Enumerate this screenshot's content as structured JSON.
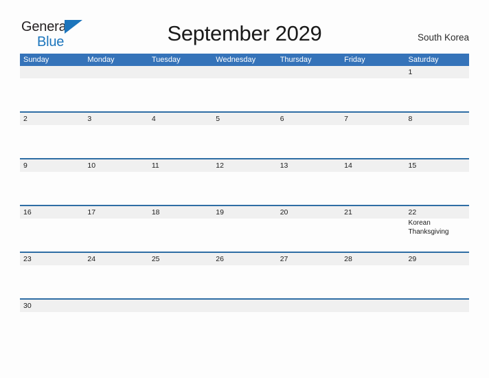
{
  "brand": {
    "name_part1": "General",
    "name_part2": "Blue",
    "triangle_icon": "blue-triangle-icon",
    "accent_color": "#1c75bc"
  },
  "header": {
    "title": "September 2029",
    "region": "South Korea"
  },
  "calendar": {
    "header_color": "#3573b9",
    "row_divider_color": "#2e6da4",
    "band_color": "#f0f0f0",
    "weekdays": [
      "Sunday",
      "Monday",
      "Tuesday",
      "Wednesday",
      "Thursday",
      "Friday",
      "Saturday"
    ],
    "weeks": [
      [
        {
          "day": "",
          "event": ""
        },
        {
          "day": "",
          "event": ""
        },
        {
          "day": "",
          "event": ""
        },
        {
          "day": "",
          "event": ""
        },
        {
          "day": "",
          "event": ""
        },
        {
          "day": "",
          "event": ""
        },
        {
          "day": "1",
          "event": ""
        }
      ],
      [
        {
          "day": "2",
          "event": ""
        },
        {
          "day": "3",
          "event": ""
        },
        {
          "day": "4",
          "event": ""
        },
        {
          "day": "5",
          "event": ""
        },
        {
          "day": "6",
          "event": ""
        },
        {
          "day": "7",
          "event": ""
        },
        {
          "day": "8",
          "event": ""
        }
      ],
      [
        {
          "day": "9",
          "event": ""
        },
        {
          "day": "10",
          "event": ""
        },
        {
          "day": "11",
          "event": ""
        },
        {
          "day": "12",
          "event": ""
        },
        {
          "day": "13",
          "event": ""
        },
        {
          "day": "14",
          "event": ""
        },
        {
          "day": "15",
          "event": ""
        }
      ],
      [
        {
          "day": "16",
          "event": ""
        },
        {
          "day": "17",
          "event": ""
        },
        {
          "day": "18",
          "event": ""
        },
        {
          "day": "19",
          "event": ""
        },
        {
          "day": "20",
          "event": ""
        },
        {
          "day": "21",
          "event": ""
        },
        {
          "day": "22",
          "event": "Korean Thanksgiving"
        }
      ],
      [
        {
          "day": "23",
          "event": ""
        },
        {
          "day": "24",
          "event": ""
        },
        {
          "day": "25",
          "event": ""
        },
        {
          "day": "26",
          "event": ""
        },
        {
          "day": "27",
          "event": ""
        },
        {
          "day": "28",
          "event": ""
        },
        {
          "day": "29",
          "event": ""
        }
      ],
      [
        {
          "day": "30",
          "event": ""
        },
        {
          "day": "",
          "event": ""
        },
        {
          "day": "",
          "event": ""
        },
        {
          "day": "",
          "event": ""
        },
        {
          "day": "",
          "event": ""
        },
        {
          "day": "",
          "event": ""
        },
        {
          "day": "",
          "event": ""
        }
      ]
    ]
  }
}
